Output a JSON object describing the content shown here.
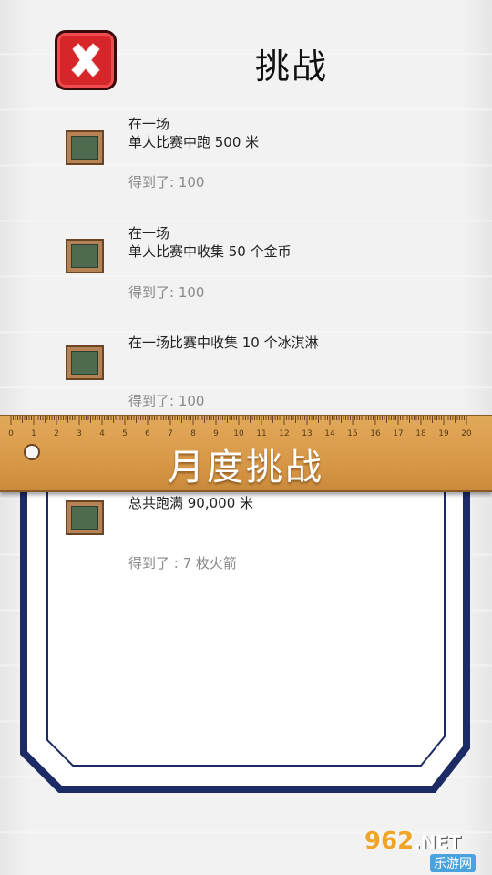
{
  "header": {
    "title": "挑战",
    "close_icon": "close-icon"
  },
  "challenges": [
    {
      "description": "在一场\n 单人比赛中跑 500 米",
      "reward": "得到了: 100"
    },
    {
      "description": "在一场\n单人比赛中收集 50 个金币",
      "reward": "得到了: 100"
    },
    {
      "description": "在一场比赛中收集 10 个冰淇淋",
      "reward": "得到了: 100"
    }
  ],
  "ruler": {
    "title": "月度挑战",
    "ticks": [
      "0",
      "1",
      "2",
      "3",
      "4",
      "5",
      "6",
      "7",
      "8",
      "9",
      "10",
      "11",
      "12",
      "13",
      "14",
      "15",
      "16",
      "17",
      "18",
      "19",
      "20"
    ]
  },
  "monthly": [
    {
      "description": "总共跑满 90,000 米",
      "reward": "得到了 : 7 枚火箭"
    }
  ],
  "watermark": {
    "top": "962",
    "suffix": ".NET",
    "bottom": "乐游网"
  },
  "colors": {
    "close_button": "#d7262a",
    "ruler": "#d89948",
    "panel_border": "#1d2b64"
  }
}
